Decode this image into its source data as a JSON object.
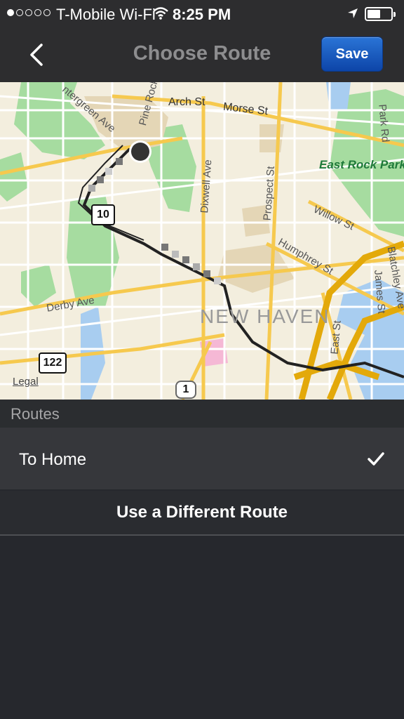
{
  "status_bar": {
    "carrier": "T-Mobile Wi-Fi",
    "time": "8:25 PM",
    "signal_bars_filled": 1,
    "signal_bars_total": 5
  },
  "nav": {
    "title": "Choose Route",
    "save_label": "Save",
    "back_icon": "chevron-left-icon"
  },
  "map": {
    "streets": [
      "Arch St",
      "Morse St",
      "ntergreen Ave",
      "Pine Rock",
      "Park Rd",
      "Dixwell Ave",
      "Prospect St",
      "Willow St",
      "Humphrey St",
      "Blatchley Ave",
      "James St",
      "East St",
      "Derby Ave"
    ],
    "places": [
      "East Rock Park",
      "NEW HAVEN"
    ],
    "route_shields": [
      "10",
      "122",
      "1"
    ],
    "legal": "Legal"
  },
  "routes": {
    "header": "Routes",
    "selected_route": "To Home",
    "alt_route_label": "Use a Different Route"
  },
  "colors": {
    "accent_blue": "#1b5cc4",
    "background": "#26282d",
    "row": "#36373b"
  }
}
